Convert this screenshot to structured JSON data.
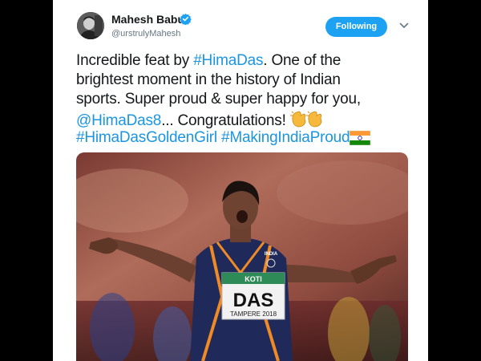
{
  "tweet": {
    "author": {
      "display_name": "Mahesh Babu",
      "handle": "@urstrulyMahesh",
      "verified": true,
      "verified_icon": "verified-badge-icon"
    },
    "follow_button_label": "Following",
    "menu_icon": "chevron-down-icon",
    "text": {
      "l1_a": "Incredible feat by ",
      "l1_tag": "#HimaDas",
      "l1_b": ". One of the",
      "l2": "brightest moment in the history of Indian",
      "l3": "sports. Super proud & super happy for you,",
      "l4_mention": "@HimaDas8",
      "l4_b": "... Congratulations!",
      "l5_tag1": "#HimaDasGoldenGirl",
      "l5_tag2": "#MakingIndiaProud",
      "emojis": [
        "clapping-hands",
        "clapping-hands",
        "india-flag"
      ]
    },
    "photo": {
      "bib_name": "DAS",
      "bib_sponsor": "KOTI",
      "bib_event": "TAMPERE 2018",
      "jersey_label": "INDIA"
    },
    "colors": {
      "link": "#1b95e0",
      "button": "#1da1f2",
      "text": "#14171a",
      "secondary": "#657786"
    }
  }
}
